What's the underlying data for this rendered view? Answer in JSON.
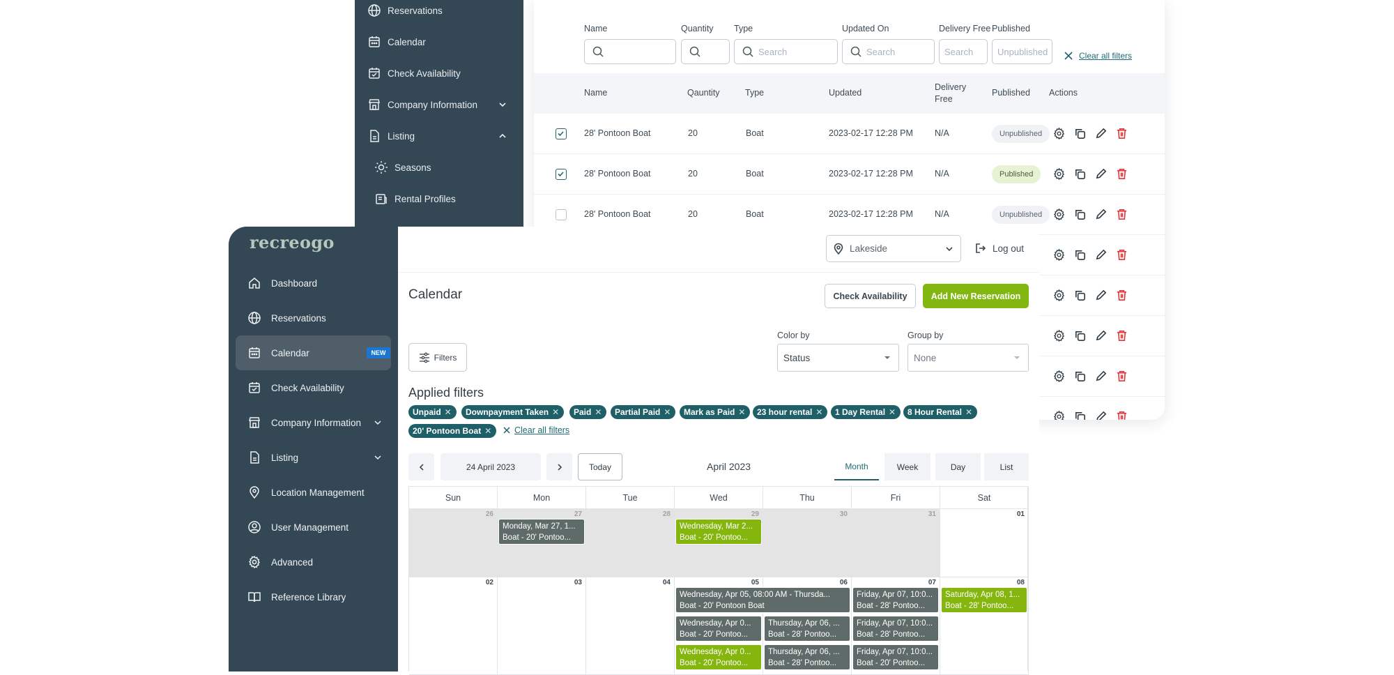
{
  "back_window": {
    "sidebar": {
      "items": [
        {
          "label": "Reservations",
          "icon": "globe-icon"
        },
        {
          "label": "Calendar",
          "icon": "calendar-icon"
        },
        {
          "label": "Check Availability",
          "icon": "calendar-check-icon"
        },
        {
          "label": "Company Information",
          "icon": "store-icon",
          "chevron": "down"
        },
        {
          "label": "Listing",
          "icon": "document-icon",
          "chevron": "up"
        },
        {
          "label": "Seasons",
          "icon": "sun-icon",
          "sub": true
        },
        {
          "label": "Rental Profiles",
          "icon": "profile-card-icon",
          "sub": true
        }
      ]
    },
    "filters": {
      "name": {
        "label": "Name",
        "placeholder": ""
      },
      "quantity": {
        "label": "Quantity",
        "placeholder": ""
      },
      "type": {
        "label": "Type",
        "placeholder": "Search"
      },
      "updated_on": {
        "label": "Updated On",
        "placeholder": "Search"
      },
      "delivery_free": {
        "label": "Delivery Free",
        "placeholder": "Search"
      },
      "published": {
        "label": "Published",
        "placeholder": "Unpublished"
      },
      "clear_all": "Clear all filters"
    },
    "table": {
      "headers": {
        "name": "Name",
        "quantity": "Qauntity",
        "type": "Type",
        "updated": "Updated",
        "delivery_free_1": "Delivery",
        "delivery_free_2": "Free",
        "published": "Published",
        "actions": "Actions"
      },
      "rows": [
        {
          "checked": true,
          "name": "28' Pontoon Boat",
          "quantity": "20",
          "type": "Boat",
          "updated": "2023-02-17 12:28 PM",
          "delivery_free": "N/A",
          "published": "Unpublished"
        },
        {
          "checked": true,
          "name": "28' Pontoon Boat",
          "quantity": "20",
          "type": "Boat",
          "updated": "2023-02-17 12:28 PM",
          "delivery_free": "N/A",
          "published": "Published"
        },
        {
          "checked": false,
          "name": "28' Pontoon Boat",
          "quantity": "20",
          "type": "Boat",
          "updated": "2023-02-17 12:28 PM",
          "delivery_free": "N/A",
          "published": "Unpublished"
        }
      ]
    }
  },
  "front_window": {
    "logo": "recreogo",
    "sidebar": {
      "items": [
        {
          "label": "Dashboard",
          "icon": "home-icon"
        },
        {
          "label": "Reservations",
          "icon": "globe-icon"
        },
        {
          "label": "Calendar",
          "icon": "calendar-icon",
          "badge": "NEW",
          "active": true
        },
        {
          "label": "Check Availability",
          "icon": "calendar-check-icon"
        },
        {
          "label": "Company Information",
          "icon": "store-icon",
          "chevron": "down"
        },
        {
          "label": "Listing",
          "icon": "document-icon",
          "chevron": "down"
        },
        {
          "label": "Location Management",
          "icon": "location-pin-icon"
        },
        {
          "label": "User Management",
          "icon": "user-circle-icon"
        },
        {
          "label": "Advanced",
          "icon": "gear-icon"
        },
        {
          "label": "Reference Library",
          "icon": "book-icon"
        }
      ]
    },
    "topbar": {
      "location": "Lakeside",
      "logout": "Log out"
    },
    "page_title": "Calendar",
    "buttons": {
      "check_availability": "Check Availability",
      "add_reservation": "Add New Reservation",
      "filters": "Filters"
    },
    "color_by": {
      "label": "Color by",
      "value": "Status"
    },
    "group_by": {
      "label": "Group by",
      "value": "None"
    },
    "applied_filters": {
      "title": "Applied filters",
      "chips": [
        "Unpaid",
        "Downpayment Taken",
        "Paid",
        "Partial Paid",
        "Mark as Paid",
        "23 hour rental",
        "1 Day Rental",
        "8 Hour Rental",
        "20' Pontoon Boat"
      ],
      "clear_all": "Clear all filters"
    },
    "calendar_nav": {
      "current_date": "24 April 2023",
      "today": "Today",
      "month_title": "April 2023",
      "views": [
        "Month",
        "Week",
        "Day",
        "List"
      ],
      "active_view": "Month"
    },
    "calendar": {
      "day_headers": [
        "Sun",
        "Mon",
        "Tue",
        "Wed",
        "Thu",
        "Fri",
        "Sat"
      ],
      "weeks": [
        {
          "days": [
            "26",
            "27",
            "28",
            "29",
            "30",
            "31",
            "01"
          ],
          "past": [
            true,
            true,
            true,
            true,
            true,
            true,
            false
          ]
        },
        {
          "days": [
            "02",
            "03",
            "04",
            "05",
            "06",
            "07",
            "08"
          ],
          "past": [
            false,
            false,
            false,
            false,
            false,
            false,
            false
          ]
        }
      ],
      "events": [
        {
          "week": 0,
          "col": 1,
          "span": 1,
          "slot": 0,
          "line1": "Monday, Mar 27, 1...",
          "line2": "Boat - 20' Pontoo...",
          "color": "gray"
        },
        {
          "week": 0,
          "col": 3,
          "span": 1,
          "slot": 0,
          "line1": "Wednesday, Mar 2...",
          "line2": "Boat - 20' Pontoo...",
          "color": "green"
        },
        {
          "week": 1,
          "col": 3,
          "span": 2,
          "slot": 0,
          "line1": "Wednesday, Apr 05, 08:00 AM - Thursda...",
          "line2": "Boat - 20' Pontoon Boat",
          "color": "gray"
        },
        {
          "week": 1,
          "col": 5,
          "span": 1,
          "slot": 0,
          "line1": "Friday, Apr 07, 10:0...",
          "line2": "Boat - 28' Pontoo...",
          "color": "gray"
        },
        {
          "week": 1,
          "col": 6,
          "span": 1,
          "slot": 0,
          "line1": "Saturday, Apr 08, 1...",
          "line2": "Boat - 28' Pontoo...",
          "color": "green"
        },
        {
          "week": 1,
          "col": 3,
          "span": 1,
          "slot": 1,
          "line1": "Wednesday, Apr 0...",
          "line2": "Boat - 20' Pontoo...",
          "color": "gray"
        },
        {
          "week": 1,
          "col": 4,
          "span": 1,
          "slot": 1,
          "line1": "Thursday, Apr 06, ...",
          "line2": "Boat - 28' Pontoo...",
          "color": "gray"
        },
        {
          "week": 1,
          "col": 5,
          "span": 1,
          "slot": 1,
          "line1": "Friday, Apr 07, 10:0...",
          "line2": "Boat - 28' Pontoo...",
          "color": "gray"
        },
        {
          "week": 1,
          "col": 3,
          "span": 1,
          "slot": 2,
          "line1": "Wednesday, Apr 0...",
          "line2": "Boat - 20' Pontoo...",
          "color": "green"
        },
        {
          "week": 1,
          "col": 4,
          "span": 1,
          "slot": 2,
          "line1": "Thursday, Apr 06, ...",
          "line2": "Boat - 28' Pontoo...",
          "color": "gray"
        },
        {
          "week": 1,
          "col": 5,
          "span": 1,
          "slot": 2,
          "line1": "Friday, Apr 07, 10:0...",
          "line2": "Boat - 20' Pontoo...",
          "color": "gray"
        }
      ]
    }
  },
  "colors": {
    "sidebar_bg": "#344754",
    "accent_teal": "#1f5f68",
    "accent_green": "#82b711",
    "event_gray": "#5f6b68",
    "delete_red": "#e0383e",
    "new_badge": "#1a76cf"
  }
}
